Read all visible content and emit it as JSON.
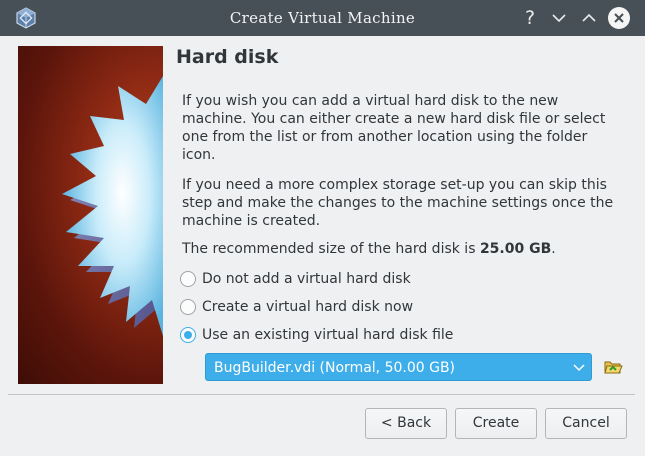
{
  "window": {
    "title": "Create Virtual Machine",
    "controls": [
      "help-icon",
      "minimize-icon",
      "maximize-icon",
      "close-icon"
    ]
  },
  "page": {
    "heading": "Hard disk",
    "paragraph1": "If you wish you can add a virtual hard disk to the new machine. You can either create a new hard disk file or select one from the list or from another location using the folder icon.",
    "paragraph2": "If you need a more complex storage set-up you can skip this step and make the changes to the machine settings once the machine is created.",
    "recommended_prefix": "The recommended size of the hard disk is ",
    "recommended_size": "25.00 GB",
    "recommended_suffix": "."
  },
  "options": [
    {
      "label": "Do not add a virtual hard disk",
      "checked": false
    },
    {
      "label": "Create a virtual hard disk now",
      "checked": false
    },
    {
      "label": "Use an existing virtual hard disk file",
      "checked": true
    }
  ],
  "disk_select": {
    "value": "BugBuilder.vdi (Normal, 50.00 GB)"
  },
  "buttons": {
    "back": "< Back",
    "create": "Create",
    "cancel": "Cancel"
  },
  "colors": {
    "titlebar": "#475057",
    "accent": "#3daee9",
    "background": "#eff0f1"
  }
}
